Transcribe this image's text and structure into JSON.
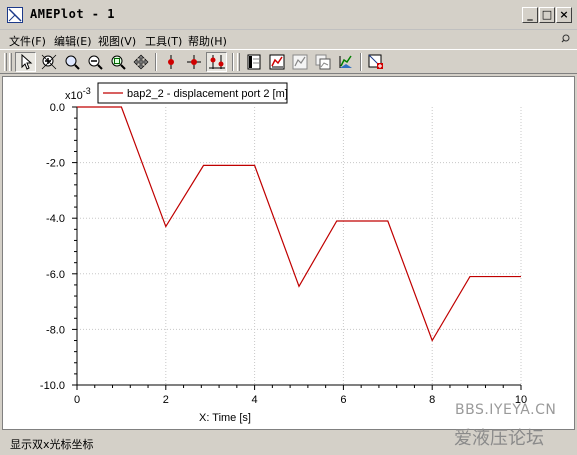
{
  "window": {
    "title": "AMEPlot - 1",
    "minimize_glyph": "_",
    "maximize_glyph": "□",
    "close_glyph": "×"
  },
  "menu": {
    "items": [
      "文件(F)",
      "编辑(E)",
      "视图(V)",
      "工具(T)",
      "帮助(H)"
    ]
  },
  "toolbar": {
    "icons": [
      "pointer-icon",
      "zoom-in-icon",
      "zoom-box-icon",
      "zoom-out-icon",
      "zoom-fit-icon",
      "pan-icon",
      "marker-icon",
      "crosshair-icon",
      "dual-cursor-icon",
      "plot-layout-icon",
      "new-plot-icon",
      "plot-template-icon",
      "copy-plot-icon",
      "3d-plot-icon",
      "export-plot-icon"
    ]
  },
  "status": {
    "text": "显示双x光标坐标"
  },
  "watermark": {
    "url": "BBS.IYEYA.CN",
    "name": "爱液压论坛"
  },
  "chart_data": {
    "type": "line",
    "title": "",
    "xlabel": "X: Time [s]",
    "ylabel": "",
    "y_multiplier": "x10",
    "y_exponent": "-3",
    "xlim": [
      0,
      10
    ],
    "ylim": [
      -10,
      0
    ],
    "x_ticks": [
      "0",
      "2",
      "4",
      "6",
      "8",
      "10"
    ],
    "y_ticks": [
      "0.0",
      "-2.0",
      "-4.0",
      "-6.0",
      "-8.0",
      "-10.0"
    ],
    "grid": true,
    "legend_position": "top-left",
    "series": [
      {
        "name": "bap2_2 - displacement port 2 [m]",
        "color": "#c00000",
        "x": [
          0,
          1.0,
          2.0,
          2.85,
          4.0,
          5.0,
          5.85,
          7.0,
          8.0,
          8.85,
          10.0
        ],
        "y": [
          0.0,
          0.0,
          -4.3,
          -2.1,
          -2.1,
          -6.45,
          -4.1,
          -4.1,
          -8.4,
          -6.1,
          -6.1
        ]
      }
    ]
  }
}
